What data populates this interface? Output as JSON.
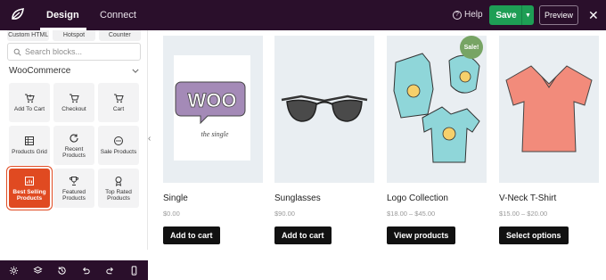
{
  "header": {
    "tabs": [
      {
        "label": "Design"
      },
      {
        "label": "Connect"
      }
    ],
    "help_label": "Help",
    "save_label": "Save",
    "preview_label": "Preview"
  },
  "sidebar": {
    "cut_blocks": [
      "Custom HTML",
      "Hotspot",
      "Counter"
    ],
    "search": {
      "placeholder": "Search blocks..."
    },
    "section_title": "WooCommerce",
    "blocks": [
      {
        "label": "Add To Cart",
        "icon": "cart-plus-icon"
      },
      {
        "label": "Checkout",
        "icon": "cart-icon"
      },
      {
        "label": "Cart",
        "icon": "cart-icon"
      },
      {
        "label": "Products Grid",
        "icon": "grid-icon"
      },
      {
        "label": "Recent Products",
        "icon": "refresh-icon"
      },
      {
        "label": "Sale Products",
        "icon": "dots-icon"
      },
      {
        "label": "Best Selling Products",
        "icon": "chart-icon"
      },
      {
        "label": "Featured Products",
        "icon": "trophy-icon"
      },
      {
        "label": "Top Rated Products",
        "icon": "award-icon"
      }
    ]
  },
  "products": [
    {
      "name": "Single",
      "price": "$0.00",
      "button": "Add to cart",
      "image_text": "WOO",
      "image_subtext": "the single"
    },
    {
      "name": "Sunglasses",
      "price": "$90.00",
      "button": "Add to cart"
    },
    {
      "name": "Logo Collection",
      "price": "$18.00 – $45.00",
      "button": "View products",
      "badge": "Sale!"
    },
    {
      "name": "V-Neck T-Shirt",
      "price": "$15.00 – $20.00",
      "button": "Select options"
    }
  ],
  "colors": {
    "topbar": "#2a0f2b",
    "save": "#1e9e55",
    "active_block": "#e04a21",
    "sale_badge": "#77a464"
  }
}
